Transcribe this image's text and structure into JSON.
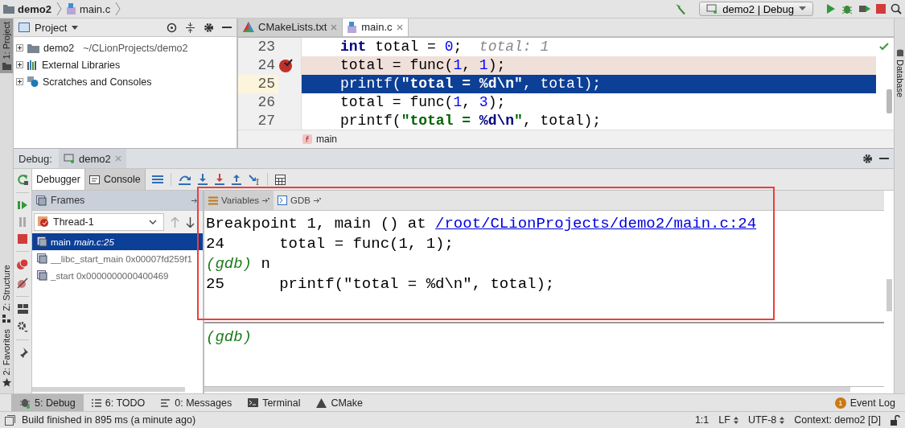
{
  "navbar": {
    "breadcrumbs": [
      {
        "label": "demo2",
        "kind": "folder"
      },
      {
        "label": "main.c",
        "kind": "cfile"
      }
    ],
    "run_config": "demo2 | Debug"
  },
  "left_strip": [
    {
      "label": "1: Project",
      "selected": true,
      "kind": "folder"
    },
    {
      "label": "Z: Structure",
      "selected": false,
      "kind": "structure"
    },
    {
      "label": "2: Favorites",
      "selected": false,
      "kind": "star"
    }
  ],
  "right_strip": [
    {
      "label": "Database"
    }
  ],
  "project": {
    "title": "Project",
    "tree": [
      {
        "name": "demo2",
        "path": "~/CLionProjects/demo2",
        "kind": "folder",
        "expanded": false
      },
      {
        "name": "External Libraries",
        "kind": "library",
        "expanded": false
      },
      {
        "name": "Scratches and Consoles",
        "kind": "scratch",
        "expanded": false
      }
    ]
  },
  "editor": {
    "tabs": [
      {
        "label": "CMakeLists.txt",
        "kind": "cmake",
        "selected": false
      },
      {
        "label": "main.c",
        "kind": "cfile",
        "selected": true
      }
    ],
    "lines": [
      {
        "number": "23",
        "breakpoint": false,
        "current": false,
        "tokens": [
          {
            "t": "int",
            "kind": "keyword"
          },
          {
            "t": " total = ",
            "kind": "plain"
          },
          {
            "t": "0",
            "kind": "number"
          },
          {
            "t": ";",
            "kind": "plain"
          },
          {
            "t": "  total: 1",
            "kind": "hint"
          }
        ]
      },
      {
        "number": "24",
        "breakpoint": true,
        "current": false,
        "tokens": [
          {
            "t": "total = func(",
            "kind": "plain"
          },
          {
            "t": "1",
            "kind": "number"
          },
          {
            "t": ", ",
            "kind": "plain"
          },
          {
            "t": "1",
            "kind": "number"
          },
          {
            "t": ");",
            "kind": "plain"
          }
        ]
      },
      {
        "number": "25",
        "breakpoint": false,
        "current": true,
        "tokens": [
          {
            "t": "printf(",
            "kind": "plain"
          },
          {
            "t": "\"total = ",
            "kind": "string"
          },
          {
            "t": "%d\\n",
            "kind": "escape"
          },
          {
            "t": "\"",
            "kind": "string"
          },
          {
            "t": ", total);",
            "kind": "plain"
          }
        ]
      },
      {
        "number": "26",
        "breakpoint": false,
        "current": false,
        "tokens": [
          {
            "t": "total = func(",
            "kind": "plain"
          },
          {
            "t": "1",
            "kind": "number"
          },
          {
            "t": ", ",
            "kind": "plain"
          },
          {
            "t": "3",
            "kind": "number"
          },
          {
            "t": ");",
            "kind": "plain"
          }
        ]
      },
      {
        "number": "27",
        "breakpoint": false,
        "current": false,
        "tokens": [
          {
            "t": "printf(",
            "kind": "plain"
          },
          {
            "t": "\"total = ",
            "kind": "string"
          },
          {
            "t": "%d\\n",
            "kind": "escape"
          },
          {
            "t": "\"",
            "kind": "string"
          },
          {
            "t": ", total);",
            "kind": "plain"
          }
        ]
      }
    ],
    "breadcrumb": "main"
  },
  "debug": {
    "label": "Debug:",
    "session": "demo2",
    "tabs": [
      {
        "label": "Debugger",
        "selected": true
      },
      {
        "label": "Console",
        "selected": false
      }
    ],
    "frames_title": "Frames",
    "thread": "Thread-1",
    "frames": [
      {
        "name": "main",
        "location": "main.c:25",
        "selected": true
      },
      {
        "name": "__libc_start_main 0x00007fd259f1",
        "selected": false
      },
      {
        "name": "_start 0x0000000000400469",
        "selected": false
      }
    ],
    "view_tabs": [
      {
        "label": "Variables",
        "kind": "variables",
        "selected": false
      },
      {
        "label": "GDB",
        "kind": "gdb",
        "selected": true
      }
    ],
    "console": [
      [
        {
          "t": "Breakpoint 1, main () at ",
          "kind": "plain"
        },
        {
          "t": "/root/CLionProjects/demo2/main.c:24",
          "kind": "link"
        }
      ],
      [
        {
          "t": "24      total = func(1, 1);",
          "kind": "plain"
        }
      ],
      [
        {
          "t": "(gdb)",
          "kind": "prompt"
        },
        {
          "t": " n",
          "kind": "plain"
        }
      ],
      [
        {
          "t": "25      printf(\"total = %d\\n\", total);",
          "kind": "plain"
        }
      ]
    ],
    "input_prompt": "(gdb)",
    "annotation": {
      "kind": "rectangle"
    }
  },
  "tool_tabs": [
    {
      "label": "5: Debug",
      "kind": "debug",
      "selected": true
    },
    {
      "label": "6: TODO",
      "kind": "list",
      "selected": false
    },
    {
      "label": "0: Messages",
      "kind": "messages",
      "selected": false
    },
    {
      "label": "Terminal",
      "kind": "terminal",
      "selected": false
    },
    {
      "label": "CMake",
      "kind": "cmake",
      "selected": false
    }
  ],
  "event_log": {
    "label": "Event Log",
    "count": "1"
  },
  "status_bar": {
    "message": "Build finished in 895 ms (a minute ago)",
    "position": "1:1",
    "line_sep": "LF",
    "encoding": "UTF-8",
    "context": "Context: demo2 [D]"
  }
}
